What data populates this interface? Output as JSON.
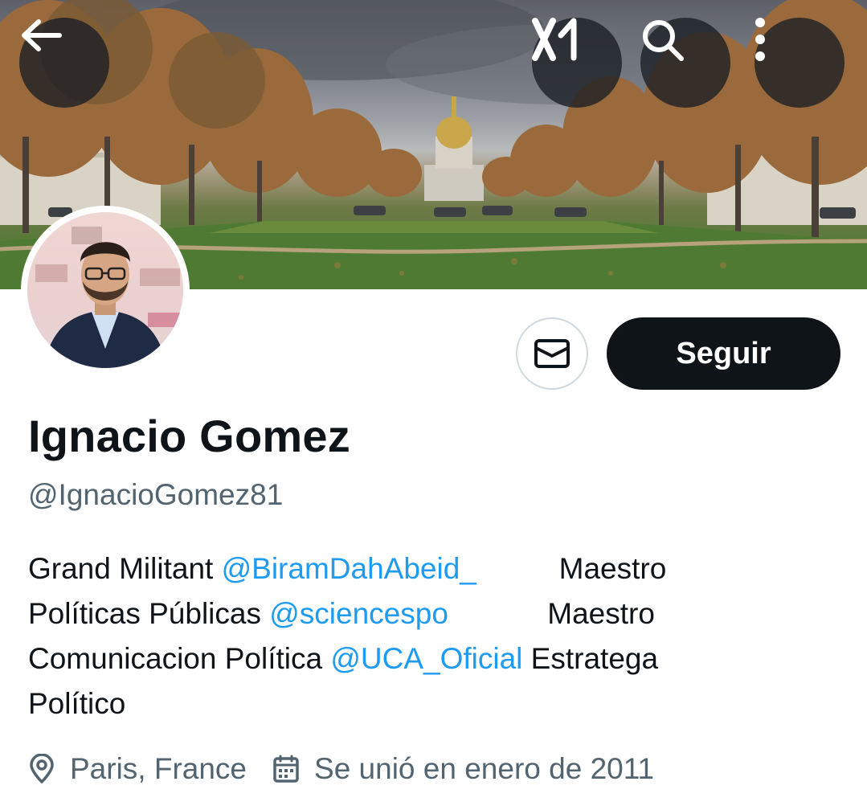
{
  "header": {
    "back_icon": "arrow-left-icon",
    "grok_icon": "grok-logo-icon",
    "search_icon": "search-icon",
    "more_icon": "more-vertical-icon"
  },
  "profile": {
    "name": "Ignacio Gomez",
    "handle": "@IgnacioGomez81",
    "message_icon": "envelope-icon",
    "follow_label": "Seguir",
    "bio": {
      "line1_text": "Grand Militant ",
      "line1_mention": "@BiramDahAbeid_",
      "line1_tail": "          Maestro",
      "line2_text": "Políticas Públicas ",
      "line2_mention": "@sciencespo",
      "line2_tail": "            Maestro",
      "line3_text": "Comunicacion Política ",
      "line3_mention": "@UCA_Oficial",
      "line3_tail": " Estratega",
      "line4_text": "Político"
    },
    "location": "Paris, France",
    "joined": "Se unió en enero de 2011",
    "location_icon": "location-pin-icon",
    "calendar_icon": "calendar-icon"
  },
  "colors": {
    "link": "#1d9bf0",
    "secondary_text": "#536471",
    "button_dark": "#0f1419"
  }
}
